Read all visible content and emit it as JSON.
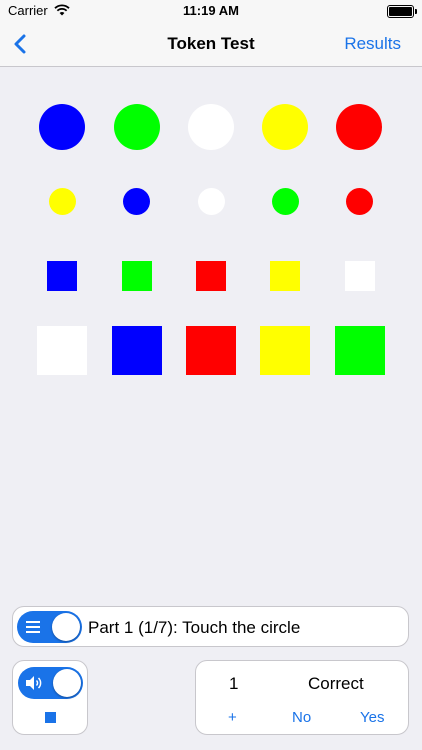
{
  "status_bar": {
    "carrier": "Carrier",
    "time": "11:19 AM",
    "wifi_icon": "wifi-icon",
    "battery_icon": "battery-icon"
  },
  "nav": {
    "back_icon": "chevron-left-icon",
    "title": "Token Test",
    "results_label": "Results"
  },
  "colors": {
    "accent": "#1a73e8",
    "blue": "#0000ff",
    "green": "#00ff00",
    "white": "#ffffff",
    "yellow": "#ffff00",
    "red": "#ff0000"
  },
  "tokens": {
    "large_circles": [
      "blue",
      "green",
      "white",
      "yellow",
      "red"
    ],
    "small_circles": [
      "yellow",
      "blue",
      "white",
      "green",
      "red"
    ],
    "small_squares": [
      "blue",
      "green",
      "red",
      "yellow",
      "white"
    ],
    "large_squares": [
      "white",
      "blue",
      "red",
      "yellow",
      "green"
    ]
  },
  "instruction": {
    "toggle_icon": "list-icon",
    "toggle_on": true,
    "text": "Part 1 (1/7): Touch the circle"
  },
  "audio": {
    "toggle_icon": "speaker-icon",
    "toggle_on": true,
    "stop_icon": "stop-icon"
  },
  "answer": {
    "count": "1",
    "result": "Correct",
    "plus": "+",
    "no": "No",
    "yes": "Yes"
  }
}
